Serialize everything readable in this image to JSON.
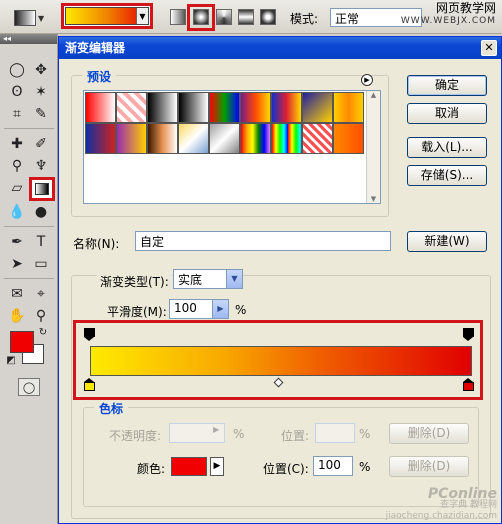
{
  "options_bar": {
    "mode_label": "模式:",
    "mode_value": "正常",
    "watermark_line1": "网页教学网",
    "watermark_line2": "WWW.WEBJX.COM"
  },
  "toolbox": {
    "collapse_glyph": "◂◂"
  },
  "dialog": {
    "title": "渐变编辑器",
    "presets_legend": "预设",
    "ok_button": "确定",
    "cancel_button": "取消",
    "load_button": "载入(L)...",
    "save_button": "存储(S)...",
    "name_label": "名称(N):",
    "name_value": "自定",
    "new_button": "新建(W)",
    "gradient_type_label": "渐变类型(T):",
    "gradient_type_value": "实底",
    "smoothness_label": "平滑度(M):",
    "smoothness_value": "100",
    "smoothness_unit": "%",
    "stops_legend": "色标",
    "opacity_label": "不透明度:",
    "opacity_unit": "%",
    "opacity_location_label": "位置:",
    "opacity_location_unit": "%",
    "opacity_delete_button": "删除(D)",
    "color_label": "颜色:",
    "color_location_label": "位置(C):",
    "color_location_value": "100",
    "color_location_unit": "%",
    "color_delete_button": "删除(D)",
    "watermark_brand": "PConline",
    "watermark_cn": "查字典 教程网",
    "watermark_url": "jiaocheng.chazidian.com"
  },
  "colors": {
    "highlight": "#d4141b",
    "stop_start": "#ffe800",
    "stop_end": "#e00000",
    "selected_color": "#f00000",
    "title_blue": "#0a46d4",
    "legend_blue": "#0046d5"
  },
  "presets": [
    "linear-gradient(90deg,#ff0000,#ffffff)",
    "repeating-linear-gradient(45deg,#ffaaaa 0 4px,#fff 4px 8px)",
    "linear-gradient(90deg,#000000,#ffffff)",
    "linear-gradient(90deg,#000000,#ffffff)",
    "linear-gradient(90deg,#ff0000,#00a000,#0000ff)",
    "linear-gradient(90deg,#7a1a8a,#ff4a00,#ffd800)",
    "linear-gradient(90deg,#1030c8,#e02030,#ffd800)",
    "linear-gradient(135deg,#2020a0,#ffd000)",
    "linear-gradient(90deg,#ffd000,#ff8800,#ffd000)",
    "linear-gradient(90deg,#1030a0,#d02020)",
    "linear-gradient(90deg,#9a2ab0,#ffd000)",
    "linear-gradient(90deg,#3a1a00,#e89050,#fff)",
    "linear-gradient(135deg,#ffd860,#fff,#7aa0d0)",
    "linear-gradient(135deg,#a0a0a0,#fff,#808080)",
    "linear-gradient(90deg,red,orange,yellow,green,blue,violet)",
    "repeating-linear-gradient(90deg,red 0,yellow 4px,lime 8px,cyan 12px,blue 16px)",
    "repeating-linear-gradient(45deg,#ff5050 0 3px,#fff 3px 6px)",
    "linear-gradient(90deg,#ff8800,#ff5000)"
  ]
}
